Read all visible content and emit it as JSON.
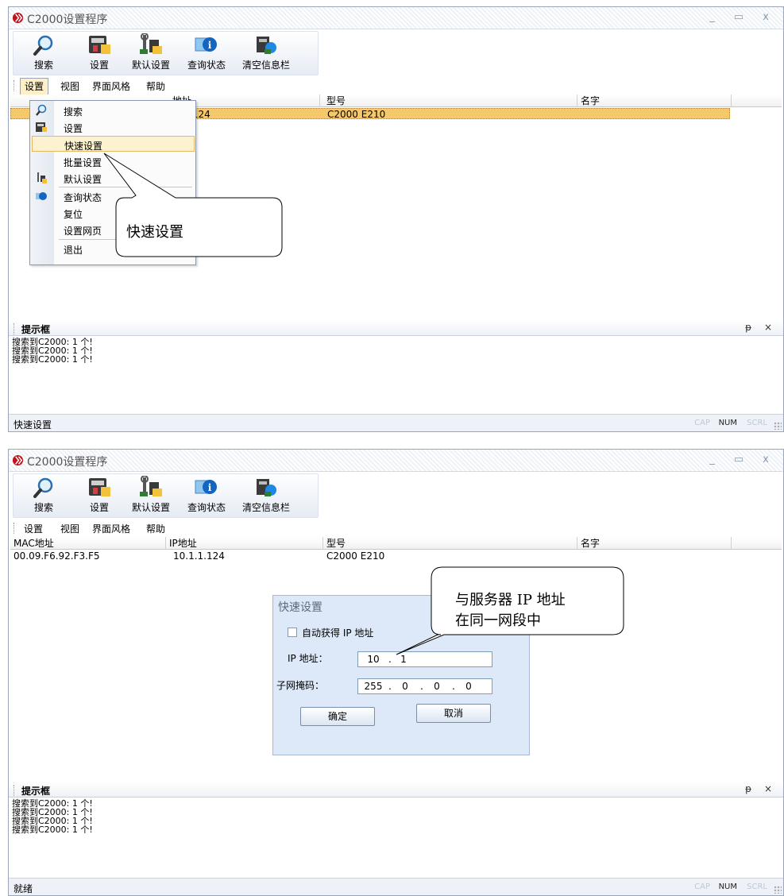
{
  "app": {
    "title": "C2000设置程序"
  },
  "toolbar": [
    {
      "label": "搜索",
      "icon": "magnifier-icon"
    },
    {
      "label": "设置",
      "icon": "settings-device-icon"
    },
    {
      "label": "默认设置",
      "icon": "tools-icon"
    },
    {
      "label": "查询状态",
      "icon": "info-monitor-icon"
    },
    {
      "label": "清空信息栏",
      "icon": "clear-info-icon"
    }
  ],
  "menu": [
    "设置",
    "视图",
    "界面风格",
    "帮助"
  ],
  "columns": [
    "MAC地址",
    "IP地址",
    "型号",
    "名字"
  ],
  "device": {
    "mac": "00.09.F6.92.F3.F5",
    "ip": "10.1.1.124",
    "model": "C2000 E210",
    "name": ""
  },
  "dropdown": {
    "items": [
      "搜索",
      "设置",
      "快速设置",
      "批量设置",
      "默认设置",
      "查询状态",
      "复位",
      "设置网页",
      "退出"
    ],
    "highlighted": "快速设置",
    "ip_partial": "1.1.124",
    "col_partial": "地址"
  },
  "callout1": {
    "text": "快速设置"
  },
  "callout2": {
    "line1": "与服务器 IP 地址",
    "line2": "在同一网段中"
  },
  "dialog": {
    "title": "快速设置",
    "auto_ip_label": "自动获得 IP 地址",
    "auto_ip_checked": false,
    "ip_label": "IP  地址：",
    "ip_visible": [
      "10",
      "1"
    ],
    "mask_label": "子网掩码：",
    "mask": [
      "255",
      "0",
      "0",
      "0"
    ],
    "ok": "确定",
    "cancel": "取消"
  },
  "hint": {
    "title": "提示框",
    "pin": "ᵽ",
    "close": "×",
    "log1": [
      "搜索到C2000: 1 个!",
      "搜索到C2000: 1 个!",
      "搜索到C2000: 1 个!"
    ],
    "log2": [
      "搜索到C2000: 1 个!",
      "搜索到C2000: 1 个!",
      "搜索到C2000: 1 个!",
      "搜索到C2000: 1 个!"
    ]
  },
  "status": {
    "text1": "快速设置",
    "text2": "就绪",
    "cap": "CAP",
    "num": "NUM",
    "scrl": "SCRL"
  },
  "window_buttons": {
    "min": "_",
    "max": "▭",
    "close": "x"
  },
  "colors": {
    "selected_row": "#f5c86a",
    "menu_highlight": "#fdf2cf",
    "dialog_bg": "#dde9f8",
    "logo_red": "#c0141c"
  }
}
